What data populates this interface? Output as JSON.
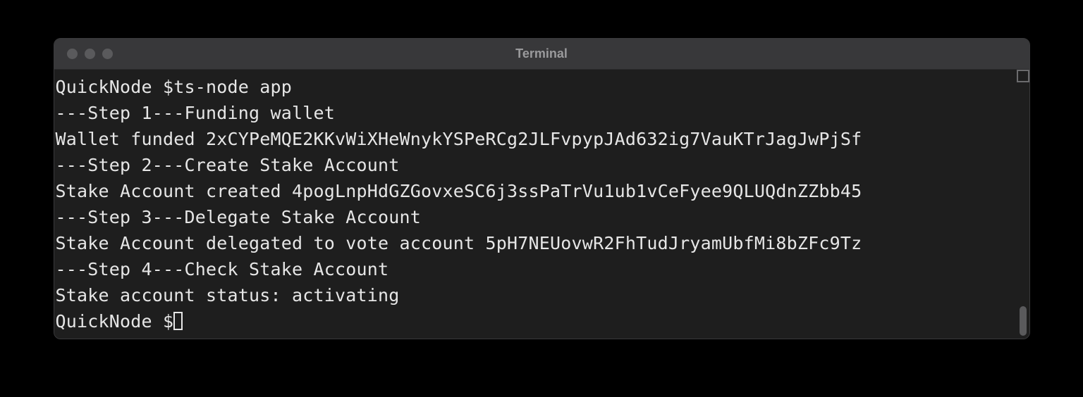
{
  "window": {
    "title": "Terminal"
  },
  "terminal": {
    "lines": [
      "QuickNode $ts-node app",
      "---Step 1---Funding wallet",
      "Wallet funded 2xCYPeMQE2KKvWiXHeWnykYSPeRCg2JLFvpypJAd632ig7VauKTrJagJwPjSf",
      "---Step 2---Create Stake Account",
      "Stake Account created 4pogLnpHdGZGovxeSC6j3ssPaTrVu1ub1vCeFyee9QLUQdnZZbb45",
      "---Step 3---Delegate Stake Account",
      "Stake Account delegated to vote account 5pH7NEUovwR2FhTudJryamUbfMi8bZFc9Tz",
      "---Step 4---Check Stake Account",
      "Stake account status: activating"
    ],
    "prompt": "QuickNode $"
  }
}
